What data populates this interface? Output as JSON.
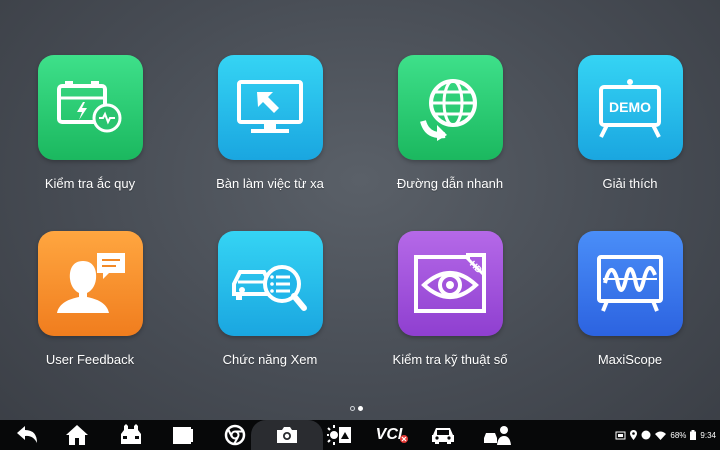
{
  "apps": [
    {
      "label": "Kiểm tra ắc quy",
      "icon": "battery-test-icon",
      "color": "#2ac46f"
    },
    {
      "label": "Bàn làm việc từ xa",
      "icon": "remote-desktop-icon",
      "color": "#22b6ea"
    },
    {
      "label": "Đường dẫn nhanh",
      "icon": "quick-link-globe-icon",
      "color": "#2ac46f"
    },
    {
      "label": "Giải thích",
      "icon": "demo-board-icon",
      "color": "#22b6ea"
    },
    {
      "label": "User Feedback",
      "icon": "user-feedback-icon",
      "color": "#f28a28"
    },
    {
      "label": "Chức năng Xem",
      "icon": "car-data-view-icon",
      "color": "#22b6ea"
    },
    {
      "label": "Kiểm tra kỹ thuật số",
      "icon": "digital-inspection-eye-icon",
      "color": "#a253de"
    },
    {
      "label": "MaxiScope",
      "icon": "oscilloscope-icon",
      "color": "#3877ec"
    }
  ],
  "icon_text": {
    "demo": "DEMO",
    "hd": "HD"
  },
  "pager": {
    "pages": 2,
    "current": 2
  },
  "navbar": {
    "items": [
      "back-icon",
      "home-icon",
      "car-repair-icon",
      "recent-apps-icon",
      "chrome-icon",
      "camera-icon",
      "display-settings-icon",
      "vci-icon",
      "car-icon",
      "technician-icon"
    ],
    "vci_label": "VCI"
  },
  "status_bar": {
    "battery": "68%",
    "time": "9:34"
  }
}
